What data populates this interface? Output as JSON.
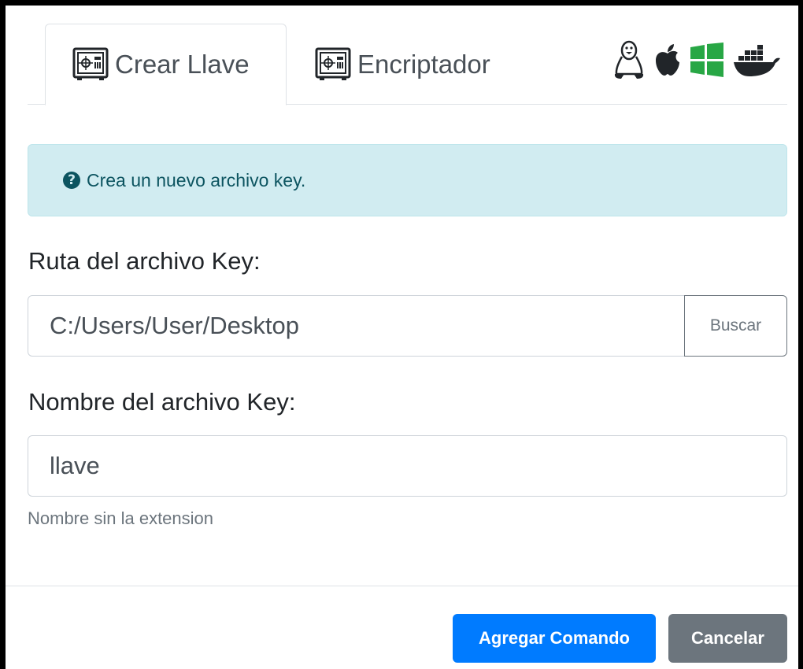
{
  "tabs": [
    {
      "label": "Crear Llave",
      "icon": "safe-icon",
      "active": true
    },
    {
      "label": "Encriptador",
      "icon": "safe-icon",
      "active": false
    }
  ],
  "os_icons": [
    "linux-icon",
    "apple-icon",
    "windows-icon",
    "docker-icon"
  ],
  "colors": {
    "windows": "#28a745",
    "primary": "#007bff",
    "secondary": "#6c757d",
    "info_bg": "#d1ecf1",
    "info_text": "#0c5460"
  },
  "alert": {
    "icon": "question-circle-icon",
    "text": "Crea un nuevo archivo key."
  },
  "form": {
    "path_label": "Ruta del archivo Key:",
    "path_value": "C:/Users/User/Desktop",
    "browse_label": "Buscar",
    "name_label": "Nombre del archivo Key:",
    "name_value": "llave",
    "name_help": "Nombre sin la extension"
  },
  "footer": {
    "add_label": "Agregar Comando",
    "cancel_label": "Cancelar"
  }
}
